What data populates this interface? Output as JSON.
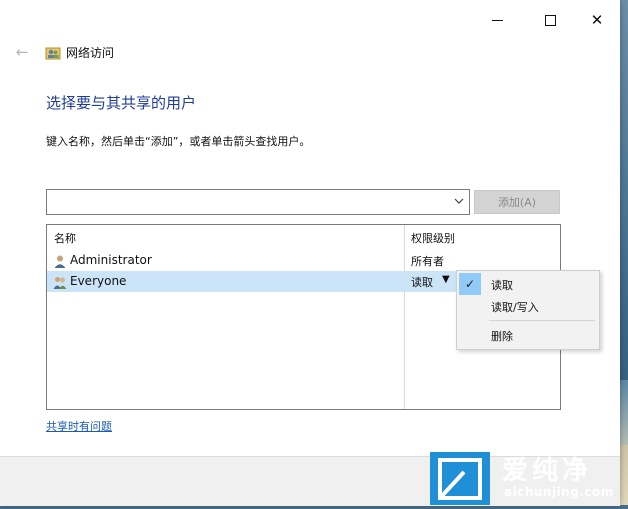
{
  "window": {
    "title": "网络访问"
  },
  "main": {
    "heading": "选择要与其共享的用户",
    "instruction": "键入名称，然后单击“添加”，或者单击箭头查找用户。",
    "combo_value": "",
    "add_button": "添加(A)",
    "help_link": "共享时有问题"
  },
  "list": {
    "columns": [
      "名称",
      "权限级别"
    ],
    "rows": [
      {
        "name": "Administrator",
        "permission": "所有者"
      },
      {
        "name": "Everyone",
        "permission": "读取"
      }
    ]
  },
  "menu": {
    "items": [
      {
        "label": "读取",
        "checked": true
      },
      {
        "label": "读取/写入",
        "checked": false
      },
      {
        "label": "删除",
        "checked": false
      }
    ]
  },
  "watermark": {
    "brand": "爱纯净",
    "url": "aichunjing.com"
  },
  "colors": {
    "heading": "#1f3c99",
    "link": "#1a5bb8",
    "selection": "#cce4f7",
    "check_highlight": "#91c9f7"
  }
}
